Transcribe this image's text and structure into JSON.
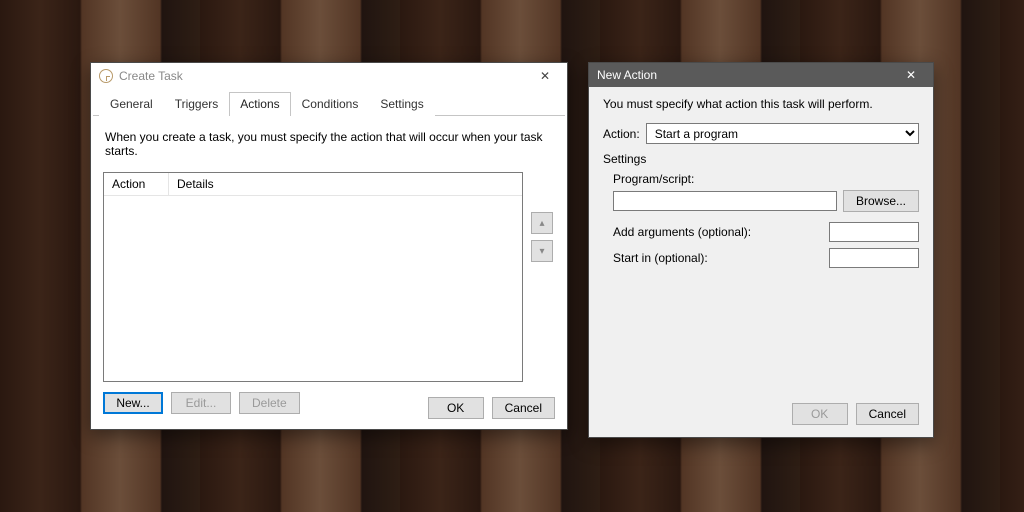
{
  "create_task": {
    "title": "Create Task",
    "close_glyph": "✕",
    "tabs": {
      "general": "General",
      "triggers": "Triggers",
      "actions": "Actions",
      "conditions": "Conditions",
      "settings": "Settings"
    },
    "description": "When you create a task, you must specify the action that will occur when your task starts.",
    "columns": {
      "action": "Action",
      "details": "Details"
    },
    "side": {
      "up_glyph": "▴",
      "down_glyph": "▾"
    },
    "buttons": {
      "new": "New...",
      "edit": "Edit...",
      "delete": "Delete",
      "ok": "OK",
      "cancel": "Cancel"
    }
  },
  "new_action": {
    "title": "New Action",
    "close_glyph": "✕",
    "instruction": "You must specify what action this task will perform.",
    "action_label": "Action:",
    "action_value": "Start a program",
    "settings_label": "Settings",
    "program_label": "Program/script:",
    "browse": "Browse...",
    "args_label": "Add arguments (optional):",
    "startin_label": "Start in (optional):",
    "ok": "OK",
    "cancel": "Cancel"
  }
}
